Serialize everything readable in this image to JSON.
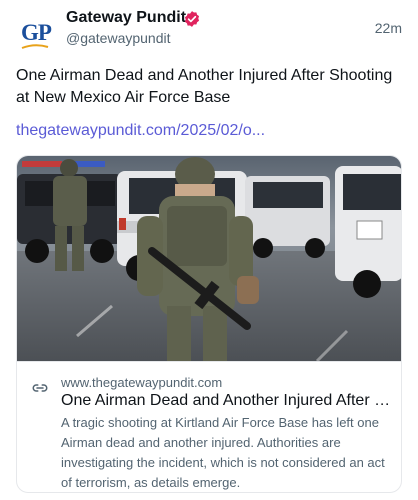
{
  "author": {
    "display_name": "Gateway Pundit",
    "handle": "@gatewaypundit",
    "avatar_text": "GP",
    "verified": true
  },
  "timestamp": "22m",
  "post": {
    "text": "One Airman Dead and Another Injured After Shooting at New Mexico Air Force Base",
    "link_text": "thegatewaypundit.com/2025/02/o..."
  },
  "card": {
    "domain": "www.thegatewaypundit.com",
    "title": "One Airman Dead and Another Injured After Shooting at New Mexico Air Force Base",
    "description": "A tragic shooting at Kirtland Air Force Base has left one Airman dead and another injured. Authorities are investigating the incident, which is not considered an act of terrorism, as details emerge."
  },
  "icons": {
    "verified": "verified-badge-icon",
    "link": "link-icon"
  },
  "colors": {
    "link": "#5b5bd6",
    "verified": "#e0245e",
    "brand": "#1b4f9c",
    "secondary_text": "#536471"
  }
}
